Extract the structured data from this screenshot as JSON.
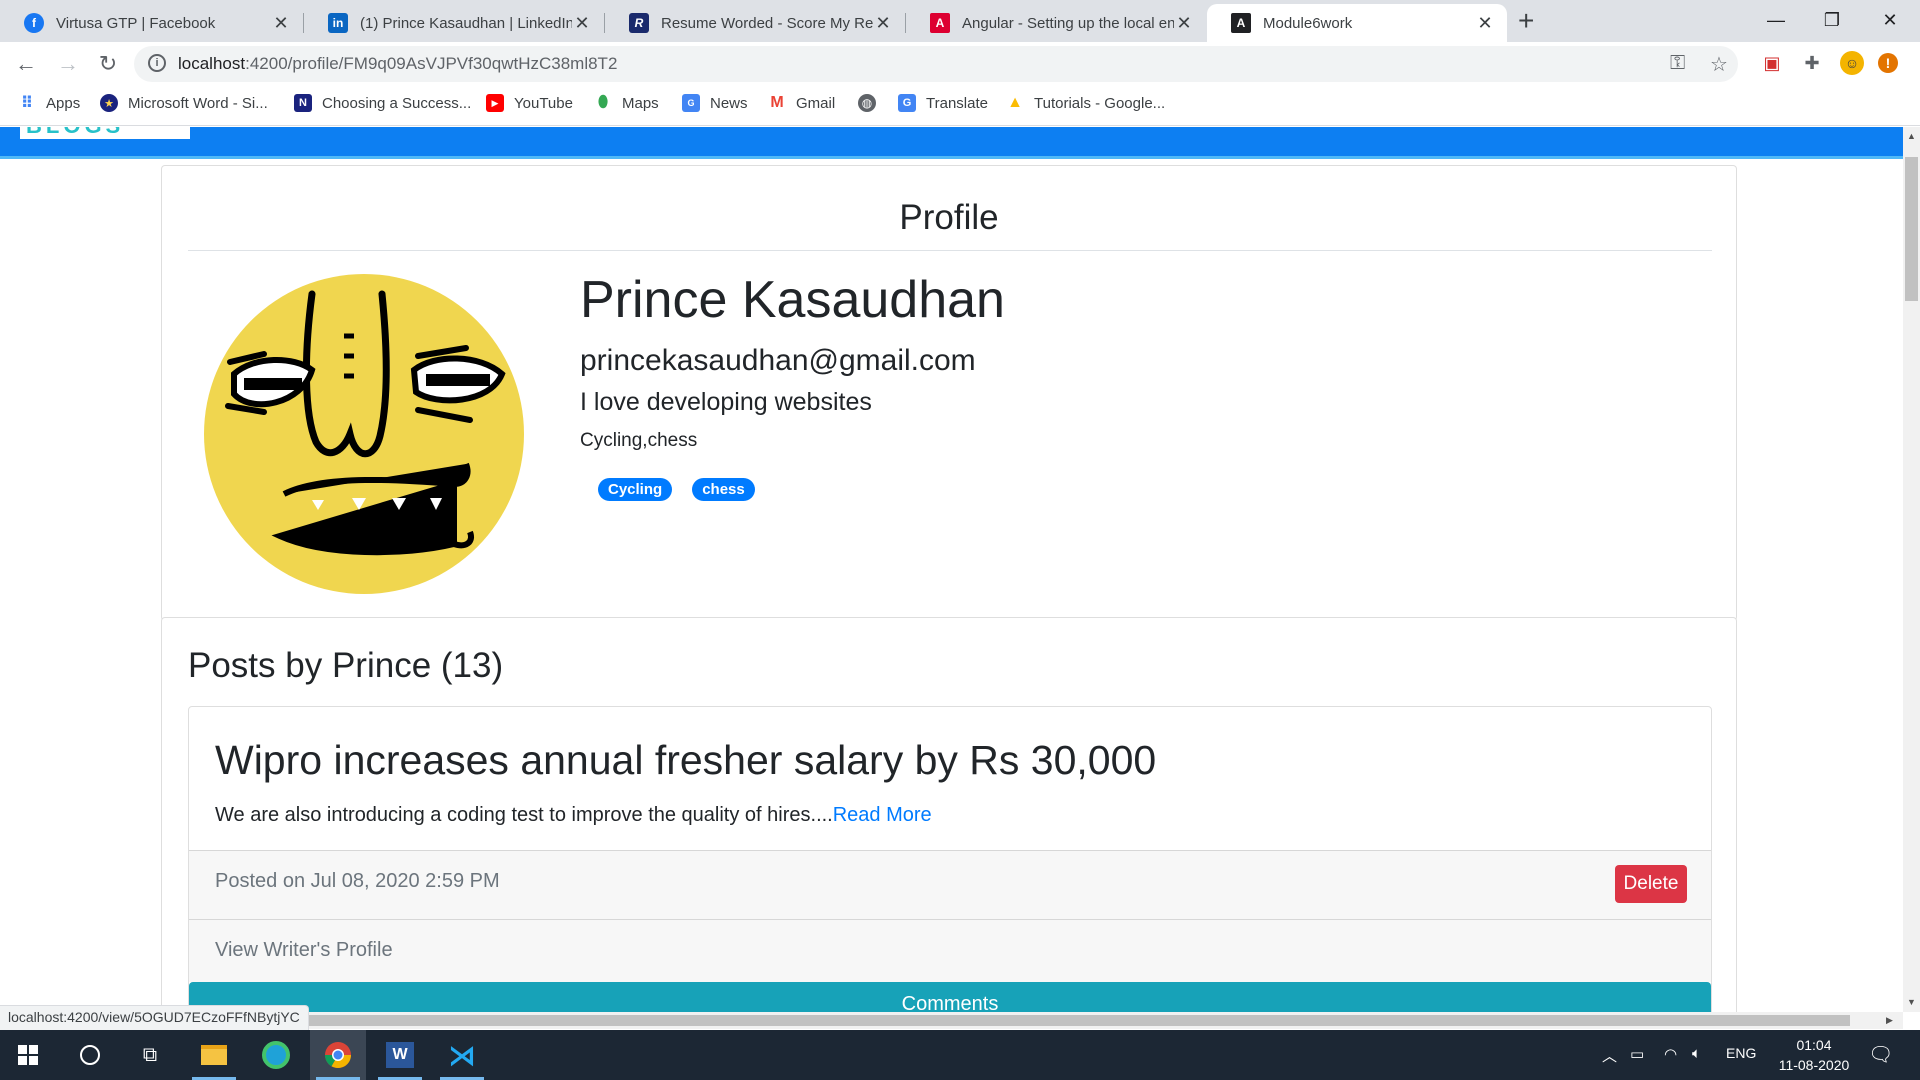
{
  "browser": {
    "tabs": [
      {
        "title": "Virtusa GTP | Facebook",
        "icon": "facebook-icon"
      },
      {
        "title": "(1) Prince Kasaudhan | LinkedIn",
        "icon": "linkedin-icon"
      },
      {
        "title": "Resume Worded - Score My Resu",
        "icon": "resume-worded-icon"
      },
      {
        "title": "Angular - Setting up the local en",
        "icon": "angular-icon"
      },
      {
        "title": "Module6work",
        "icon": "angular-icon",
        "active": true
      }
    ],
    "url_host": "localhost",
    "url_path": ":4200/profile/FM9q09AsVJPVf30qwtHzC38ml8T2",
    "bookmarks": [
      {
        "label": "Apps",
        "icon": "apps-grid-icon"
      },
      {
        "label": "Microsoft Word - Si...",
        "icon": "bookmark-site-icon"
      },
      {
        "label": "Choosing a Success...",
        "icon": "notion-icon"
      },
      {
        "label": "YouTube",
        "icon": "youtube-icon"
      },
      {
        "label": "Maps",
        "icon": "maps-pin-icon"
      },
      {
        "label": "News",
        "icon": "news-icon"
      },
      {
        "label": "Gmail",
        "icon": "gmail-icon"
      },
      {
        "label": "",
        "icon": "globe-icon"
      },
      {
        "label": "Translate",
        "icon": "translate-icon"
      },
      {
        "label": "Tutorials - Google...",
        "icon": "google-drive-icon"
      }
    ],
    "status_url": "localhost:4200/view/5OGUD7ECzoFFfNBytjYC"
  },
  "app": {
    "logo": "BLOGS"
  },
  "profile": {
    "heading": "Profile",
    "name": "Prince Kasaudhan",
    "email": "princekasaudhan@gmail.com",
    "bio": "I love developing websites",
    "interests": "Cycling,chess",
    "tags": [
      "Cycling",
      "chess"
    ]
  },
  "posts": {
    "heading": "Posts by Prince (13)",
    "items": [
      {
        "title": "Wipro increases annual fresher salary by Rs 30,000",
        "excerpt": "We are also introducing a coding test to improve the quality of hires....",
        "read_more": "Read More",
        "posted_on": "Posted on Jul 08, 2020 2:59 PM",
        "delete_label": "Delete",
        "writer_link": "View Writer's Profile",
        "comments_label": "Comments"
      }
    ]
  },
  "taskbar": {
    "language": "ENG",
    "time": "01:04",
    "date": "11-08-2020"
  },
  "colors": {
    "app_nav": "#0d7ff2",
    "tag": "#007bff",
    "delete": "#dc3545",
    "comments": "#17a2b8",
    "avatar_face": "#f0d64f"
  }
}
